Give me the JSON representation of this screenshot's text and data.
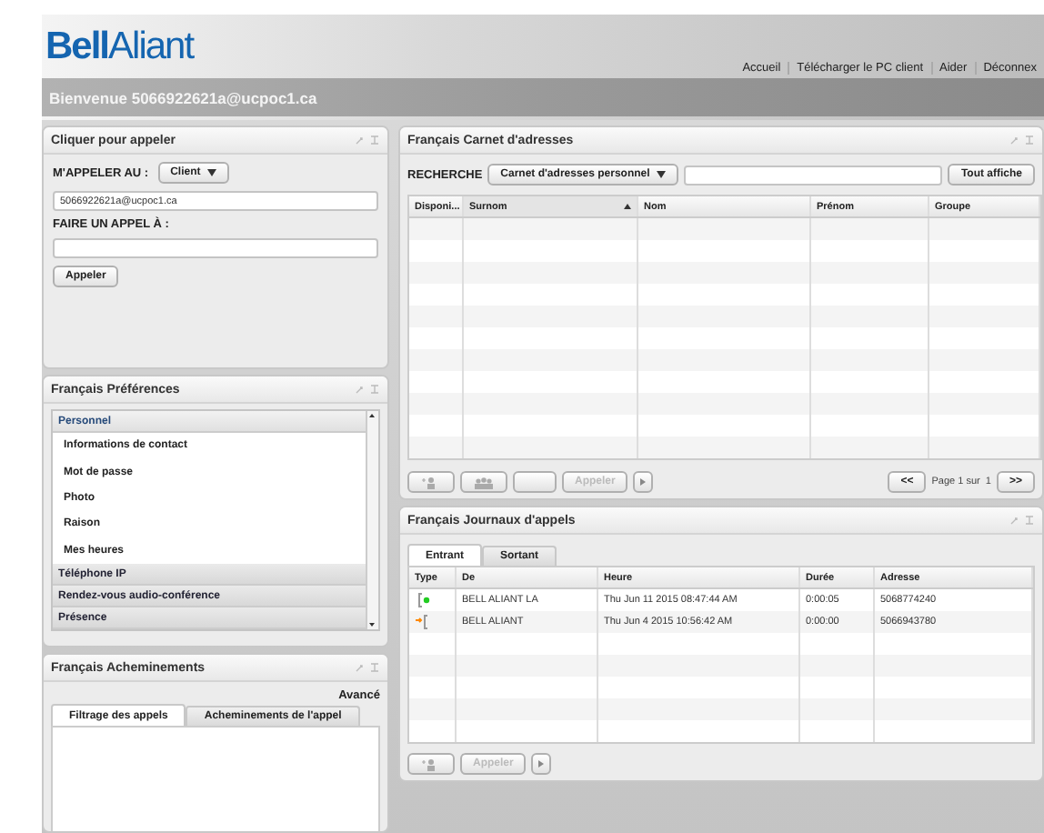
{
  "header": {
    "logo_bold": "Bell",
    "logo_light": "Aliant",
    "nav": [
      "Accueil",
      "Télécharger le PC client",
      "Aider",
      "Déconnex"
    ],
    "welcome": "Bienvenue 5066922621a@ucpoc1.ca"
  },
  "click_to_call": {
    "title": "Cliquer pour appeler",
    "call_me_label": "M'APPELER AU :",
    "call_me_select": "Client",
    "call_me_value": "5066922621a@ucpoc1.ca",
    "make_call_label": "FAIRE UN APPEL À :",
    "call_button": "Appeler"
  },
  "preferences": {
    "title": "Français Préférences",
    "sections": [
      {
        "label": "Personnel",
        "expanded": true,
        "items": [
          "Informations de contact",
          "Mot de passe",
          "Photo",
          "Raison",
          "Mes heures"
        ]
      },
      {
        "label": "Téléphone IP",
        "expanded": false
      },
      {
        "label": "Rendez-vous audio-conférence",
        "expanded": false
      },
      {
        "label": "Présence",
        "expanded": false
      }
    ]
  },
  "routing": {
    "title": "Français Acheminements",
    "advanced": "Avancé",
    "tabs": [
      {
        "label": "Filtrage des appels",
        "selected": true
      },
      {
        "label": "Acheminements de l'appel",
        "selected": false
      }
    ]
  },
  "address_book": {
    "title": "Français Carnet d'adresses",
    "search_label": "RECHERCHE",
    "book_select": "Carnet d'adresses personnel",
    "show_all": "Tout affiche",
    "columns": [
      {
        "label": "Disponi...",
        "sorted": false
      },
      {
        "label": "Surnom",
        "sorted": true
      },
      {
        "label": "Nom",
        "sorted": false
      },
      {
        "label": "Prénom",
        "sorted": false
      },
      {
        "label": "Groupe",
        "sorted": false
      }
    ],
    "call_button": "Appeler",
    "first_page": "<<",
    "page": "Page 1 sur  1",
    "next_page": ">>"
  },
  "call_log": {
    "title": "Français Journaux d'appels",
    "tabs": [
      {
        "label": "Entrant",
        "selected": true
      },
      {
        "label": "Sortant",
        "selected": false
      }
    ],
    "columns": [
      "Type",
      "De",
      "Heure",
      "Durée",
      "Adresse"
    ],
    "rows": [
      {
        "kind": "incoming",
        "from": "BELL ALIANT LA",
        "time": "Thu Jun 11 2015 08:47:44 AM",
        "duration": "0:00:05",
        "address": "5068774240"
      },
      {
        "kind": "outgoing",
        "from": "BELL ALIANT",
        "time": "Thu Jun 4 2015 10:56:42 AM",
        "duration": "0:00:00",
        "address": "5066943780"
      }
    ],
    "call_button": "Appeler"
  }
}
